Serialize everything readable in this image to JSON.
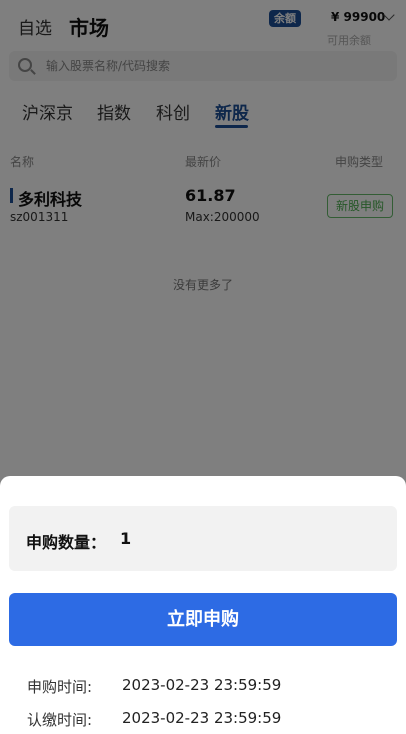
{
  "header": {
    "tab_watchlist": "自选",
    "tab_market": "市场",
    "balance_badge": "余额",
    "balance_amount": "¥ 99900",
    "balance_label": "可用余额"
  },
  "search": {
    "placeholder": "输入股票名称/代码搜索"
  },
  "market_tabs": [
    {
      "label": "沪深京"
    },
    {
      "label": "指数"
    },
    {
      "label": "科创"
    },
    {
      "label": "新股"
    }
  ],
  "active_tab": "新股",
  "table": {
    "columns": [
      "名称",
      "最新价",
      "申购类型"
    ],
    "rows": [
      {
        "name": "多利科技",
        "code": "sz001311",
        "price": "61.87",
        "max": "Max:200000",
        "type": "新股申购"
      }
    ],
    "end_text": "没有更多了"
  },
  "sheet": {
    "quantity_label": "申购数量：",
    "quantity_value": "1",
    "buy_button": "立即申购",
    "subscribe_time_label": "申购时间:",
    "subscribe_time_value": "2023-02-23 23:59:59",
    "payment_time_label": "认缴时间:",
    "payment_time_value": "2023-02-23 23:59:59"
  },
  "colors": {
    "primary": "#1c4f96",
    "button": "#2d6be4",
    "tag_green": "#4caf50"
  }
}
